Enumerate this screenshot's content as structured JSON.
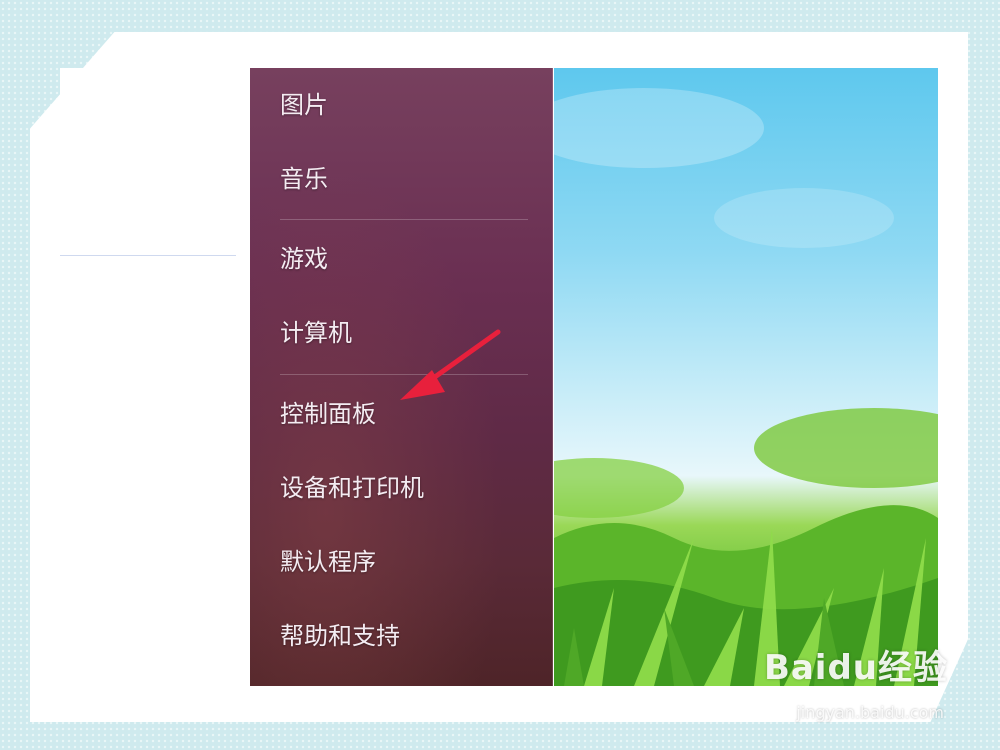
{
  "start_menu": {
    "items": [
      {
        "label": "图片"
      },
      {
        "label": "音乐"
      },
      {
        "label": "游戏"
      },
      {
        "label": "计算机"
      },
      {
        "label": "控制面板"
      },
      {
        "label": "设备和打印机"
      },
      {
        "label": "默认程序"
      },
      {
        "label": "帮助和支持"
      }
    ]
  },
  "annotation": {
    "icon": "red-arrow-icon",
    "color": "#e8203c"
  },
  "watermark": {
    "logo": "Baidu经验",
    "url": "jingyan.baidu.com"
  }
}
